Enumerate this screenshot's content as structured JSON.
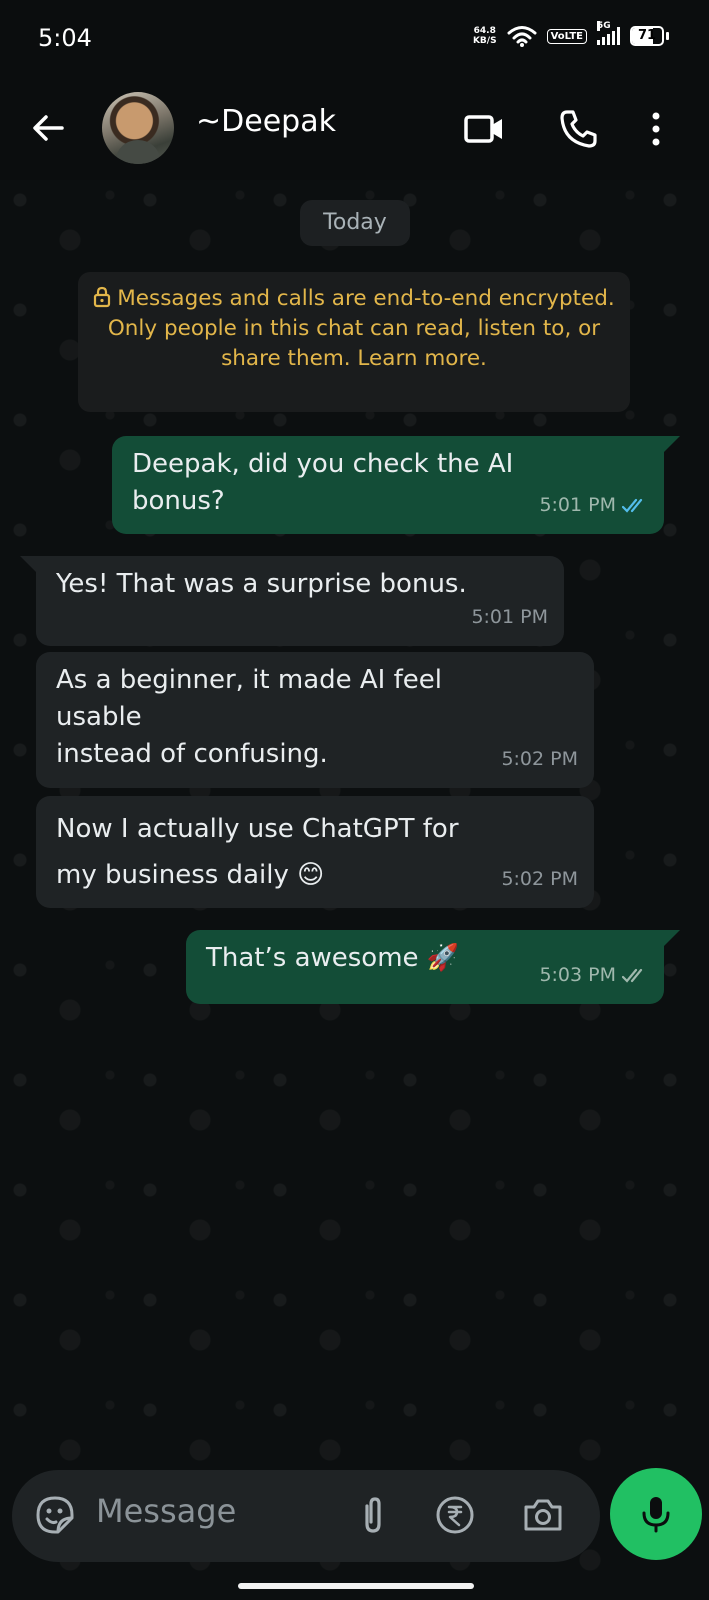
{
  "status_bar": {
    "time": "5:04",
    "net_speed_value": "64.8",
    "net_speed_unit": "KB/S",
    "volte": "VoLTE",
    "network": "5G",
    "battery": "71"
  },
  "header": {
    "contact_name": "~Deepak"
  },
  "chat": {
    "date_chip": "Today",
    "encryption_notice": "Messages and calls are end-to-end encrypted. Only people in this chat can read, listen to, or share them. Learn more.",
    "messages": [
      {
        "direction": "out",
        "lines": [
          "Deepak, did you check the AI",
          "bonus?"
        ],
        "time": "5:01 PM",
        "status": "read"
      },
      {
        "direction": "in",
        "lines": [
          "Yes! That was a surprise bonus."
        ],
        "time": "5:01 PM"
      },
      {
        "direction": "in",
        "lines": [
          "As a beginner, it made AI feel",
          "usable",
          "instead of confusing."
        ],
        "time": "5:02 PM"
      },
      {
        "direction": "in",
        "lines": [
          "Now I actually use ChatGPT for",
          "my business daily 😊"
        ],
        "time": "5:02 PM"
      },
      {
        "direction": "out",
        "lines": [
          "That’s awesome 🚀"
        ],
        "time": "5:03 PM",
        "status": "delivered"
      }
    ]
  },
  "input": {
    "placeholder": "Message"
  },
  "colors": {
    "outgoing_bubble": "#134d37",
    "incoming_bubble": "#1f2325",
    "mic_button": "#21c063",
    "encryption_text": "#e2b64a",
    "read_ticks": "#53bdeb"
  }
}
